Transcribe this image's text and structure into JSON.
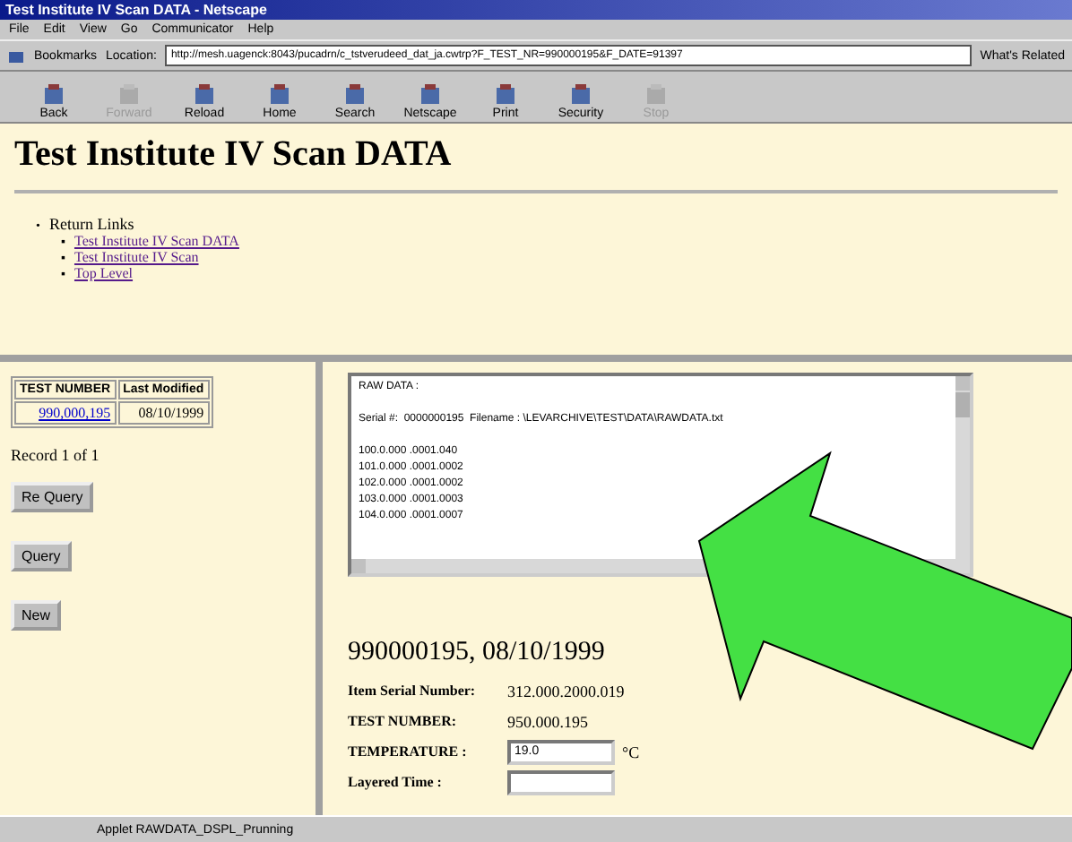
{
  "window": {
    "title": "Test Institute IV Scan DATA - Netscape"
  },
  "menu": [
    "File",
    "Edit",
    "View",
    "Go",
    "Communicator",
    "Help"
  ],
  "location_bar": {
    "bookmarks": "Bookmarks",
    "label": "Location:",
    "url": "http://mesh.uagenck:8043/pucadrn/c_tstverudeed_dat_ja.cwtrp?F_TEST_NR=990000195&F_DATE=91397",
    "related": "What's Related"
  },
  "toolbar": [
    {
      "label": "Back",
      "disabled": false
    },
    {
      "label": "Forward",
      "disabled": true
    },
    {
      "label": "Reload",
      "disabled": false
    },
    {
      "label": "Home",
      "disabled": false
    },
    {
      "label": "Search",
      "disabled": false
    },
    {
      "label": "Netscape",
      "disabled": false
    },
    {
      "label": "Print",
      "disabled": false
    },
    {
      "label": "Security",
      "disabled": false
    },
    {
      "label": "Stop",
      "disabled": true
    }
  ],
  "top_frame": {
    "heading": "Test Institute IV Scan DATA",
    "links_bullet": "•",
    "links_title": "Return Links",
    "link_bullet": "▪",
    "links": [
      "Test Institute IV Scan DATA",
      "Test Institute IV Scan",
      "Top Level"
    ]
  },
  "left_frame": {
    "columns": [
      "TEST NUMBER",
      "Last Modified"
    ],
    "rows": [
      [
        "990,000,195",
        "08/10/1999"
      ]
    ],
    "record": "Record 1 of 1",
    "buttons": [
      "Re Query",
      "Query",
      "New"
    ]
  },
  "right_frame": {
    "raw_data": {
      "header": "RAW DATA :",
      "file_line": "Serial #:  0000000195  Filename : \\LEVARCHIVE\\TEST\\DATA\\RAWDATA.txt",
      "values": [
        "100.0.000 .0001.040",
        "101.0.000 .0001.0002",
        "102.0.000 .0001.0002",
        "103.0.000 .0001.0003",
        "104.0.000 .0001.0007"
      ]
    },
    "title": "990000195, 08/10/1999",
    "fields": [
      {
        "label": "Item Serial Number:",
        "kind": "text",
        "value": "312.000.2000.019"
      },
      {
        "label": "TEST NUMBER:",
        "kind": "text",
        "value": "950.000.195"
      },
      {
        "label": "TEMPERATURE :",
        "kind": "input",
        "value": "19.0",
        "unit": "°C"
      },
      {
        "label": "Layered Time :",
        "kind": "input"
      }
    ]
  },
  "status_bar": {
    "text": "Applet RAWDATA_DSPL_Prunning"
  }
}
